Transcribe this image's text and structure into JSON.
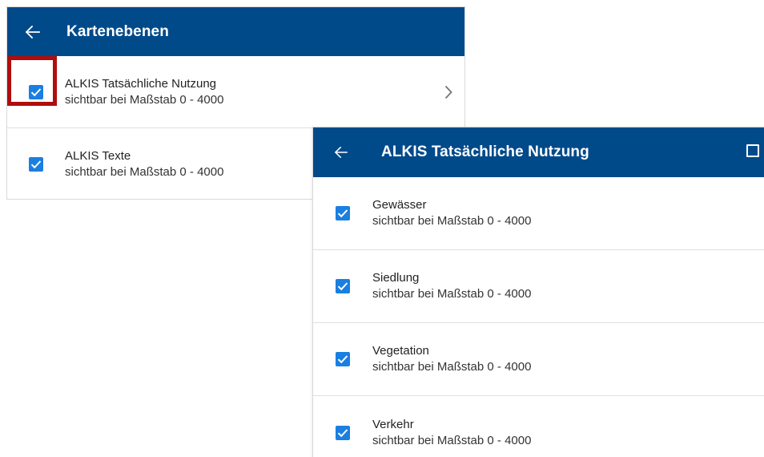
{
  "panel_main": {
    "title": "Kartenebenen",
    "items": [
      {
        "title": "ALKIS Tatsächliche Nutzung",
        "subtitle": "sichtbar bei Maßstab 0 - 4000",
        "checked": true,
        "has_submenu": true,
        "highlighted": true
      },
      {
        "title": "ALKIS Texte",
        "subtitle": "sichtbar bei Maßstab 0 - 4000",
        "checked": true,
        "has_submenu": false
      }
    ]
  },
  "panel_sub": {
    "title": "ALKIS Tatsächliche Nutzung",
    "items": [
      {
        "title": "Gewässer",
        "subtitle": "sichtbar bei Maßstab 0 - 4000",
        "checked": true
      },
      {
        "title": "Siedlung",
        "subtitle": "sichtbar bei Maßstab 0 - 4000",
        "checked": true
      },
      {
        "title": "Vegetation",
        "subtitle": "sichtbar bei Maßstab 0 - 4000",
        "checked": true
      },
      {
        "title": "Verkehr",
        "subtitle": "sichtbar bei Maßstab 0 - 4000",
        "checked": true
      }
    ]
  },
  "colors": {
    "appbar": "#004a8a",
    "checkbox": "#1a7fe0",
    "highlight": "#b00d0d"
  },
  "icons": {
    "back": "arrow-left-icon",
    "submenu": "chevron-right-icon",
    "checkbox": "checkbox-checked-icon",
    "select_all": "checkbox-outline-icon"
  }
}
